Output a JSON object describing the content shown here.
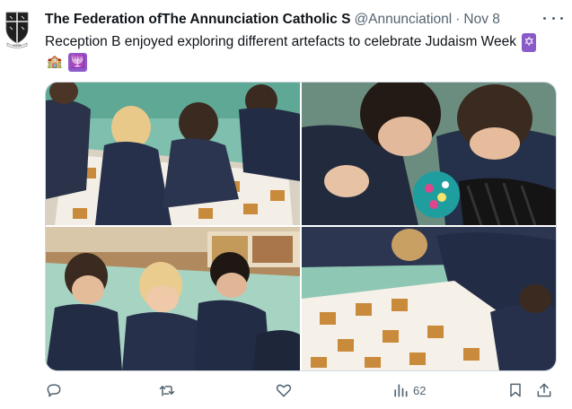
{
  "tweet": {
    "author_name": "The Federation ofThe Annunciation Catholic S",
    "handle": "@Annunciationl",
    "separator": "·",
    "date": "Nov 8",
    "text": "Reception B enjoyed exploring different artefacts to celebrate Judaism Week",
    "emojis": [
      "✡",
      "🏫",
      "🕎"
    ],
    "avatar_text": "1975",
    "views": "62"
  },
  "icons": {
    "avatar": "school-crest-icon",
    "more": "more-icon",
    "reply": "reply-icon",
    "retweet": "retweet-icon",
    "like": "heart-icon",
    "views": "views-icon",
    "bookmark": "bookmark-icon",
    "share": "share-icon"
  },
  "colors": {
    "text": "#0f1419",
    "secondary": "#536471",
    "border": "#cfd9de",
    "emoji_purple": "#8b5ac9"
  }
}
